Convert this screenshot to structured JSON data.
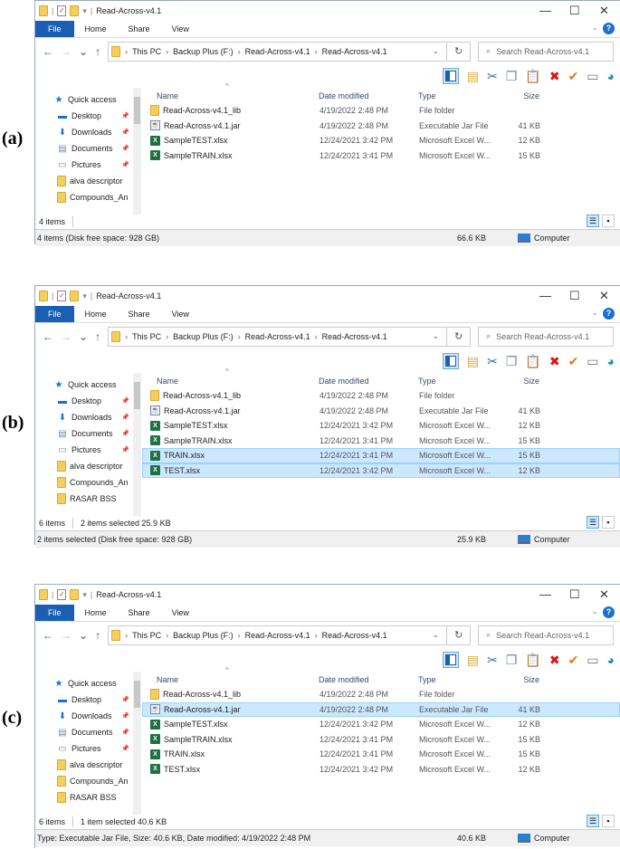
{
  "panels": [
    {
      "label": "(a)",
      "title": "Read-Across-v4.1",
      "tabs": [
        "File",
        "Home",
        "Share",
        "View"
      ],
      "path": [
        "This PC",
        "Backup Plus (F:)",
        "Read-Across-v4.1",
        "Read-Across-v4.1"
      ],
      "search_placeholder": "Search Read-Across-v4.1",
      "nav": [
        {
          "label": "Quick access",
          "icon": "star"
        },
        {
          "label": "Desktop",
          "icon": "desktop",
          "pin": true
        },
        {
          "label": "Downloads",
          "icon": "download",
          "pin": true
        },
        {
          "label": "Documents",
          "icon": "documents",
          "pin": true
        },
        {
          "label": "Pictures",
          "icon": "pictures",
          "pin": true
        },
        {
          "label": "alva descriptor",
          "icon": "folder"
        },
        {
          "label": "Compounds_An",
          "icon": "folder"
        }
      ],
      "columns": [
        "Name",
        "Date modified",
        "Type",
        "Size"
      ],
      "files": [
        {
          "name": "Read-Across-v4.1_lib",
          "date": "4/19/2022 2:48 PM",
          "type": "File folder",
          "size": "",
          "icon": "folder"
        },
        {
          "name": "Read-Across-v4.1.jar",
          "date": "4/19/2022 2:48 PM",
          "type": "Executable Jar File",
          "size": "41 KB",
          "icon": "jar"
        },
        {
          "name": "SampleTEST.xlsx",
          "date": "12/24/2021 3:42 PM",
          "type": "Microsoft Excel W...",
          "size": "12 KB",
          "icon": "excel"
        },
        {
          "name": "SampleTRAIN.xlsx",
          "date": "12/24/2021 3:41 PM",
          "type": "Microsoft Excel W...",
          "size": "15 KB",
          "icon": "excel"
        }
      ],
      "status_items": "4 items",
      "status_selected": "",
      "statusbar_text": "4 items (Disk free space: 928 GB)",
      "statusbar_size": "66.6 KB",
      "statusbar_location": "Computer"
    },
    {
      "label": "(b)",
      "title": "Read-Across-v4.1",
      "tabs": [
        "File",
        "Home",
        "Share",
        "View"
      ],
      "path": [
        "This PC",
        "Backup Plus (F:)",
        "Read-Across-v4.1",
        "Read-Across-v4.1"
      ],
      "search_placeholder": "Search Read-Across-v4.1",
      "nav": [
        {
          "label": "Quick access",
          "icon": "star"
        },
        {
          "label": "Desktop",
          "icon": "desktop",
          "pin": true
        },
        {
          "label": "Downloads",
          "icon": "download",
          "pin": true
        },
        {
          "label": "Documents",
          "icon": "documents",
          "pin": true
        },
        {
          "label": "Pictures",
          "icon": "pictures",
          "pin": true
        },
        {
          "label": "alva descriptor",
          "icon": "folder"
        },
        {
          "label": "Compounds_An",
          "icon": "folder"
        },
        {
          "label": "RASAR BSS",
          "icon": "folder"
        }
      ],
      "columns": [
        "Name",
        "Date modified",
        "Type",
        "Size"
      ],
      "files": [
        {
          "name": "Read-Across-v4.1_lib",
          "date": "4/19/2022 2:48 PM",
          "type": "File folder",
          "size": "",
          "icon": "folder"
        },
        {
          "name": "Read-Across-v4.1.jar",
          "date": "4/19/2022 2:48 PM",
          "type": "Executable Jar File",
          "size": "41 KB",
          "icon": "jar"
        },
        {
          "name": "SampleTEST.xlsx",
          "date": "12/24/2021 3:42 PM",
          "type": "Microsoft Excel W...",
          "size": "12 KB",
          "icon": "excel"
        },
        {
          "name": "SampleTRAIN.xlsx",
          "date": "12/24/2021 3:41 PM",
          "type": "Microsoft Excel W...",
          "size": "15 KB",
          "icon": "excel"
        },
        {
          "name": "TRAIN.xlsx",
          "date": "12/24/2021 3:41 PM",
          "type": "Microsoft Excel W...",
          "size": "15 KB",
          "icon": "excel",
          "selected": true
        },
        {
          "name": "TEST.xlsx",
          "date": "12/24/2021 3:42 PM",
          "type": "Microsoft Excel W...",
          "size": "12 KB",
          "icon": "excel",
          "selected": true
        }
      ],
      "status_items": "6 items",
      "status_selected": "2 items selected  25.9 KB",
      "statusbar_text": "2 items selected (Disk free space: 928 GB)",
      "statusbar_size": "25.9 KB",
      "statusbar_location": "Computer"
    },
    {
      "label": "(c)",
      "title": "Read-Across-v4.1",
      "tabs": [
        "File",
        "Home",
        "Share",
        "View"
      ],
      "path": [
        "This PC",
        "Backup Plus (F:)",
        "Read-Across-v4.1",
        "Read-Across-v4.1"
      ],
      "search_placeholder": "Search Read-Across-v4.1",
      "nav": [
        {
          "label": "Quick access",
          "icon": "star"
        },
        {
          "label": "Desktop",
          "icon": "desktop",
          "pin": true
        },
        {
          "label": "Downloads",
          "icon": "download",
          "pin": true
        },
        {
          "label": "Documents",
          "icon": "documents",
          "pin": true
        },
        {
          "label": "Pictures",
          "icon": "pictures",
          "pin": true
        },
        {
          "label": "alva descriptor",
          "icon": "folder"
        },
        {
          "label": "Compounds_An",
          "icon": "folder"
        },
        {
          "label": "RASAR BSS",
          "icon": "folder"
        }
      ],
      "columns": [
        "Name",
        "Date modified",
        "Type",
        "Size"
      ],
      "files": [
        {
          "name": "Read-Across-v4.1_lib",
          "date": "4/19/2022 2:48 PM",
          "type": "File folder",
          "size": "",
          "icon": "folder"
        },
        {
          "name": "Read-Across-v4.1.jar",
          "date": "4/19/2022 2:48 PM",
          "type": "Executable Jar File",
          "size": "41 KB",
          "icon": "jar",
          "selected": true
        },
        {
          "name": "SampleTEST.xlsx",
          "date": "12/24/2021 3:42 PM",
          "type": "Microsoft Excel W...",
          "size": "12 KB",
          "icon": "excel"
        },
        {
          "name": "SampleTRAIN.xlsx",
          "date": "12/24/2021 3:41 PM",
          "type": "Microsoft Excel W...",
          "size": "15 KB",
          "icon": "excel"
        },
        {
          "name": "TRAIN.xlsx",
          "date": "12/24/2021 3:41 PM",
          "type": "Microsoft Excel W...",
          "size": "15 KB",
          "icon": "excel"
        },
        {
          "name": "TEST.xlsx",
          "date": "12/24/2021 3:42 PM",
          "type": "Microsoft Excel W...",
          "size": "12 KB",
          "icon": "excel"
        }
      ],
      "status_items": "6 items",
      "status_selected": "1 item selected  40.6 KB",
      "statusbar_text": "Type: Executable Jar File, Size: 40.6 KB, Date modified: 4/19/2022 2:48 PM",
      "statusbar_size": "40.6 KB",
      "statusbar_location": "Computer"
    }
  ]
}
